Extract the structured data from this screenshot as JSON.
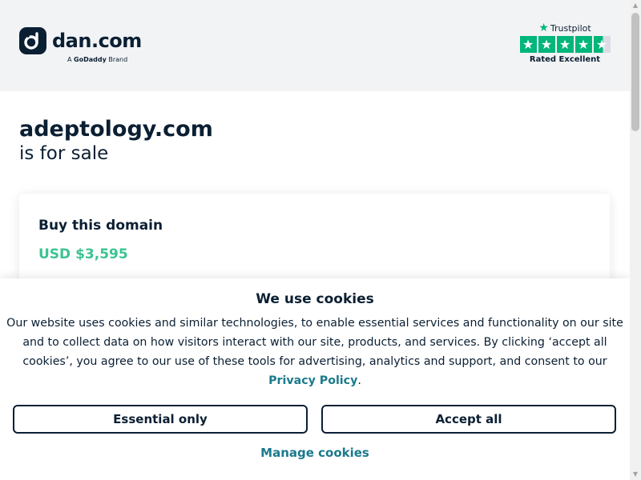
{
  "header": {
    "logo_text": "dan.com",
    "brand_prefix": "A",
    "brand_name": "GoDaddy",
    "brand_suffix": "Brand",
    "trustpilot": {
      "label": "Trustpilot",
      "rating_text": "Rated Excellent",
      "stars": 4.5
    }
  },
  "main": {
    "domain": "adeptology.com",
    "subtitle": "is for sale",
    "buy_card": {
      "title": "Buy this domain",
      "price": "USD $3,595"
    }
  },
  "cookie_banner": {
    "title": "We use cookies",
    "text": "Our website uses cookies and similar technologies, to enable essential services and functionality on our site and to collect data on how visitors interact with our site, products, and services. By clicking ‘accept all cookies’, you agree to our use of these tools for advertising, analytics and support, and consent to our",
    "policy_link": "Privacy Policy",
    "text_end": ".",
    "essential_label": "Essential only",
    "accept_label": "Accept all",
    "manage_label": "Manage cookies"
  },
  "colors": {
    "navy": "#0b1f33",
    "price_green": "#3bc391",
    "link_teal": "#1a7a8c",
    "trustpilot_green": "#00b67a"
  }
}
